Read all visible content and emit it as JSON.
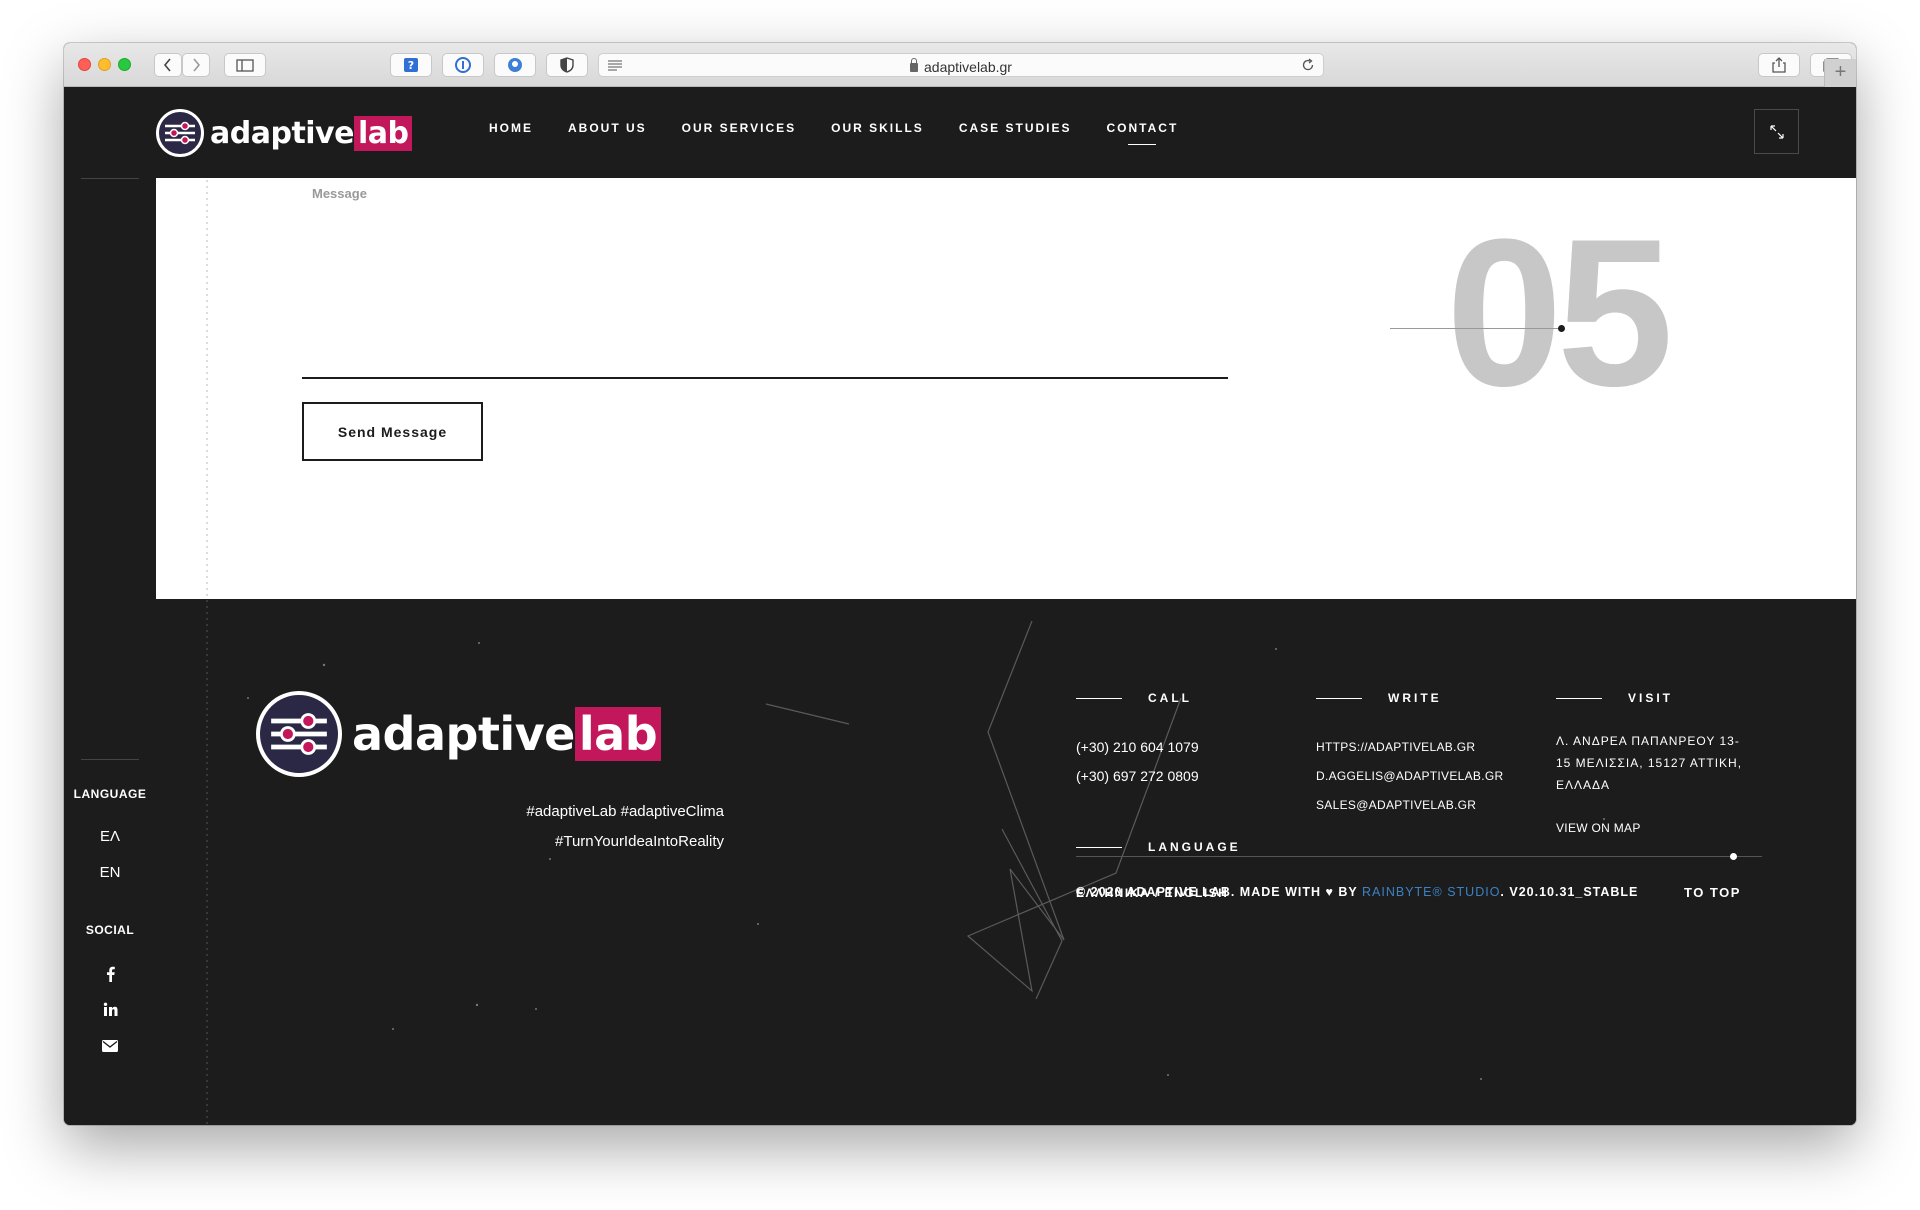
{
  "browser": {
    "url": "adaptivelab.gr"
  },
  "header": {
    "logo_text": "adaptive",
    "logo_accent": "lab",
    "nav": [
      {
        "label": "HOME",
        "active": false
      },
      {
        "label": "ABOUT US",
        "active": false
      },
      {
        "label": "OUR SERVICES",
        "active": false
      },
      {
        "label": "OUR SKILLS",
        "active": false
      },
      {
        "label": "CASE STUDIES",
        "active": false
      },
      {
        "label": "CONTACT",
        "active": true
      }
    ]
  },
  "form": {
    "message_label": "Message",
    "message_value": "",
    "send_label": "Send Message",
    "section_number": "05"
  },
  "sidebar": {
    "language_title": "LANGUAGE",
    "languages": [
      "ΕΛ",
      "EN"
    ],
    "social_title": "SOCIAL",
    "social_icons": [
      "facebook-icon",
      "linkedin-icon",
      "envelope-icon"
    ]
  },
  "footer": {
    "logo_text": "adaptive",
    "logo_accent": "lab",
    "hashtags_line1": "#adaptiveLab #adaptiveClima",
    "hashtags_line2": "#TurnYourIdeaIntoReality",
    "call_title": "CALL",
    "phones": [
      "(+30) 210 604 1079",
      "(+30) 697 272 0809"
    ],
    "write_title": "WRITE",
    "emails": [
      "HTTPS://ADAPTIVELAB.GR",
      "D.AGGELIS@ADAPTIVELAB.GR",
      "SALES@ADAPTIVELAB.GR"
    ],
    "visit_title": "VISIT",
    "address_lines": [
      "Λ. ΑΝΔΡΕΑ ΠΑΠΑΝΡΕΟΥ 13-",
      "15 ΜΕΛΙΣΣΙΑ, 15127 ΑΤΤΙΚΗ,",
      "ΕΛΛΑΔΑ"
    ],
    "view_on_map": "VIEW ON MAP",
    "language_title": "LANGUAGE",
    "language_links": "ΕΛΛΗΝΙΚΑ / ENGLISH",
    "copyright_pre": "© 2020 ADAPTIVE LAB. MADE WITH ♥ BY ",
    "copyright_brand": "RAINBYTE® STUDIO",
    "copyright_post": ". V20.10.31_STABLE",
    "to_top": "TO TOP"
  },
  "colors": {
    "dark_bg": "#1c1c1d",
    "brand_accent": "#c2185b",
    "link_blue": "#3b82c4",
    "number_grey": "#c7c7c7"
  }
}
